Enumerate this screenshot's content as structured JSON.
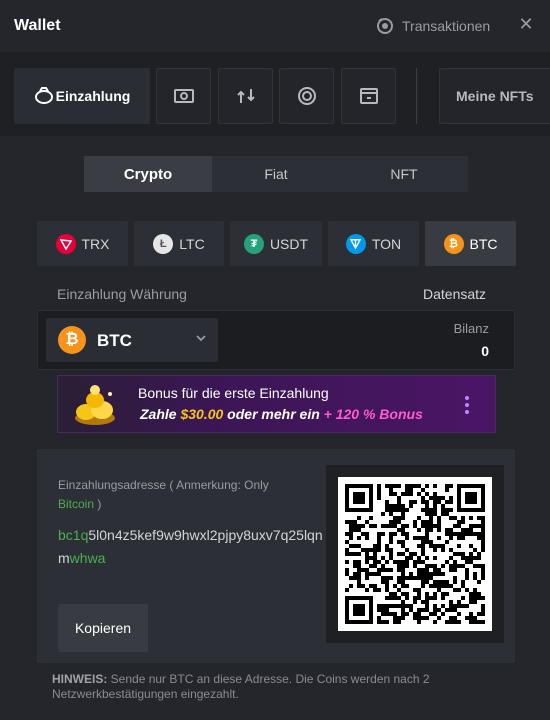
{
  "header": {
    "title": "Wallet",
    "transactions_label": "Transaktionen",
    "close_glyph": "✕"
  },
  "menu": {
    "deposit_label": "Einzahlung",
    "nfts_label": "Meine NFTs",
    "icons": [
      "deposit-icon",
      "cash-icon",
      "swap-icon",
      "coin-icon",
      "vault-icon"
    ]
  },
  "segments": [
    "Crypto",
    "Fiat",
    "NFT"
  ],
  "active_segment": "Crypto",
  "coins": [
    {
      "label": "TRX",
      "color": "#e5003a",
      "icon": "trx-icon"
    },
    {
      "label": "LTC",
      "color": "#bfbbbb",
      "icon": "ltc-icon"
    },
    {
      "label": "USDT",
      "color": "#26a17b",
      "icon": "usdt-icon"
    },
    {
      "label": "TON",
      "color": "#0098ea",
      "icon": "ton-icon"
    },
    {
      "label": "BTC",
      "color": "#f7931a",
      "icon": "btc-icon"
    }
  ],
  "active_coin": "BTC",
  "currency": {
    "label": "Einzahlung Währung",
    "rate_label": "Datensatz",
    "selected": "BTC",
    "balance_label": "Bilanz",
    "balance_value": "0"
  },
  "bonus": {
    "line1": "Bonus für die erste Einzahlung",
    "line2_prefix": "Zahle ",
    "line2_amount": "$30.00",
    "line2_mid": " oder mehr ein ",
    "line2_bonus": "+ 120 % Bonus"
  },
  "address": {
    "label_prefix": "Einzahlungsadresse ( Anmerkung: Only ",
    "label_network": "Bitcoin",
    "label_suffix": " )",
    "value_start": "bc1q",
    "value_middle": "5l0n4z5kef9w9hwxl2pjpy8uxv7q25lqnm",
    "value_end": "whwa",
    "copy_label": "Kopieren"
  },
  "note": {
    "prefix": "HINWEIS:",
    "text": " Sende nur BTC an diese Adresse. Die Coins werden nach 2 Netzwerkbestätigungen eingezahlt."
  },
  "colors": {
    "accent_green": "#4caf50",
    "bonus_gold": "#f5c518",
    "bonus_pink": "#ff5bd2",
    "btc_orange": "#f7931a"
  }
}
